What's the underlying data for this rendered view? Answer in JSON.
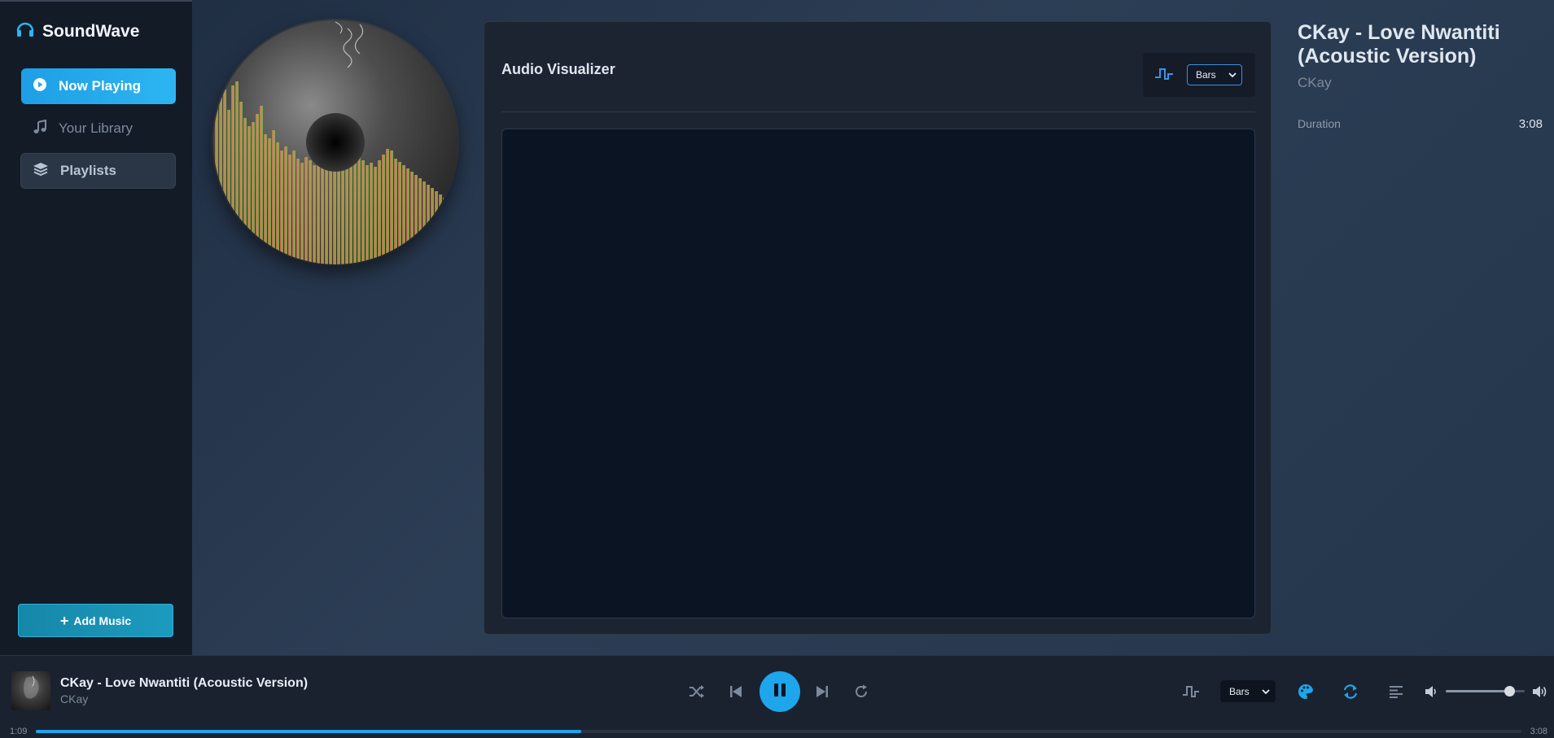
{
  "sidebar": {
    "brand": "SoundWave",
    "items": [
      {
        "label": "Now Playing",
        "icon": "play-circle-icon",
        "active": true
      },
      {
        "label": "Your Library",
        "icon": "music-note-icon"
      },
      {
        "label": "Playlists",
        "icon": "layers-icon"
      }
    ],
    "add_music_label": "Add Music"
  },
  "visualizer": {
    "title": "Audio Visualizer",
    "mode": "Bars",
    "mode_options": [
      "Bars"
    ]
  },
  "track": {
    "title": "CKay - Love Nwantiti (Acoustic Version)",
    "artist": "CKay",
    "duration_label": "Duration",
    "duration": "3:08"
  },
  "player": {
    "title": "CKay - Love Nwantiti (Acoustic Version)",
    "artist": "CKay",
    "current_time": "1:09",
    "total_time": "3:08",
    "progress": 0.367,
    "volume": 0.8,
    "mode": "Bars",
    "state": "playing"
  },
  "colors": {
    "accent": "#1da6ec",
    "sidebar_bg": "#131b27",
    "panel_bg": "#1c2431",
    "canvas_bg": "#0b1423"
  }
}
